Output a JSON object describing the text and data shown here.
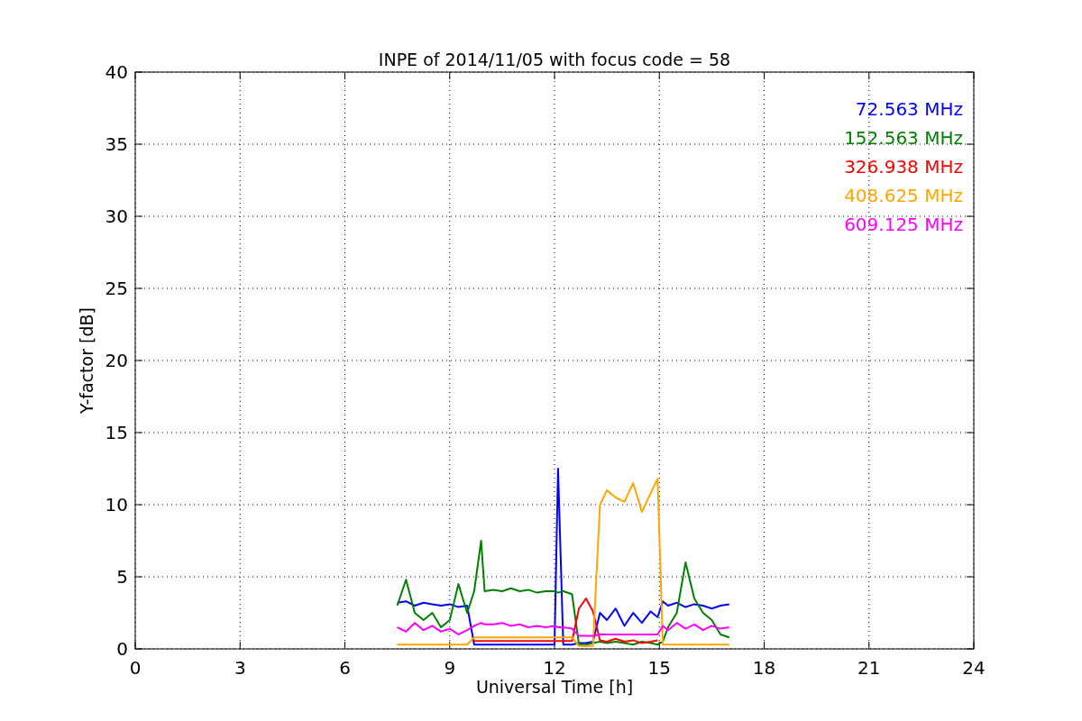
{
  "chart_data": {
    "type": "line",
    "title": "INPE of 2014/11/05 with focus code = 58",
    "xlabel": "Universal Time [h]",
    "ylabel": "Y-factor [dB]",
    "x": [
      7.5,
      7.75,
      8.0,
      8.25,
      8.5,
      8.75,
      9.0,
      9.25,
      9.5,
      9.7,
      9.9,
      10.0,
      10.25,
      10.5,
      10.75,
      11.0,
      11.25,
      11.5,
      11.75,
      12.0,
      12.1,
      12.25,
      12.5,
      12.7,
      12.9,
      13.1,
      13.3,
      13.5,
      13.75,
      14.0,
      14.25,
      14.5,
      14.75,
      14.95,
      15.1,
      15.25,
      15.5,
      15.75,
      16.0,
      16.25,
      16.5,
      16.75,
      17.0
    ],
    "series": [
      {
        "name": "72.563 MHz",
        "color": "#0000ff",
        "values": [
          3.2,
          3.3,
          3.0,
          3.2,
          3.1,
          3.0,
          3.1,
          2.9,
          3.0,
          0.3,
          0.3,
          0.3,
          0.3,
          0.3,
          0.3,
          0.3,
          0.3,
          0.3,
          0.3,
          0.3,
          12.5,
          0.3,
          0.3,
          0.4,
          0.4,
          0.5,
          2.5,
          2.0,
          2.8,
          1.6,
          2.5,
          1.8,
          2.6,
          2.2,
          3.3,
          3.0,
          3.2,
          2.9,
          3.1,
          3.0,
          2.8,
          3.0,
          3.1
        ]
      },
      {
        "name": "152.563 MHz",
        "color": "#008000",
        "values": [
          3.0,
          4.8,
          2.5,
          2.0,
          2.5,
          1.5,
          2.0,
          4.5,
          2.5,
          4.0,
          7.5,
          4.0,
          4.1,
          4.0,
          4.2,
          4.0,
          4.1,
          3.9,
          4.0,
          4.0,
          3.9,
          4.0,
          3.8,
          0.3,
          0.3,
          0.4,
          0.5,
          0.4,
          0.5,
          0.4,
          0.3,
          0.5,
          0.4,
          0.3,
          0.5,
          1.5,
          2.5,
          6.0,
          3.5,
          2.5,
          2.0,
          1.0,
          0.8
        ]
      },
      {
        "name": "326.938 MHz",
        "color": "#ff0000",
        "values": [
          null,
          null,
          null,
          null,
          null,
          null,
          null,
          null,
          null,
          0.55,
          0.55,
          0.55,
          0.55,
          0.55,
          0.55,
          0.55,
          0.55,
          0.55,
          0.55,
          0.55,
          0.55,
          0.55,
          0.55,
          2.8,
          3.5,
          2.6,
          0.6,
          0.5,
          0.7,
          0.5,
          0.6,
          0.4,
          0.5,
          0.6,
          null,
          null,
          null,
          null,
          null,
          null,
          null,
          null,
          null
        ]
      },
      {
        "name": "408.625 MHz",
        "color": "#ffa500",
        "values": [
          0.3,
          0.3,
          0.3,
          0.3,
          0.3,
          0.3,
          0.3,
          0.3,
          0.3,
          0.8,
          0.8,
          0.8,
          0.8,
          0.8,
          0.8,
          0.8,
          0.8,
          0.8,
          0.8,
          0.8,
          0.8,
          0.8,
          0.8,
          0.2,
          0.2,
          0.2,
          10.0,
          11.0,
          10.5,
          10.2,
          11.5,
          9.5,
          10.8,
          11.8,
          0.3,
          0.3,
          0.3,
          0.3,
          0.3,
          0.3,
          0.3,
          0.3,
          0.3
        ]
      },
      {
        "name": "609.125 MHz",
        "color": "#ff00ff",
        "values": [
          1.5,
          1.2,
          1.8,
          1.3,
          1.6,
          1.2,
          1.4,
          1.0,
          1.3,
          1.6,
          1.8,
          1.7,
          1.7,
          1.8,
          1.6,
          1.7,
          1.5,
          1.6,
          1.5,
          1.6,
          1.5,
          1.5,
          1.4,
          0.9,
          0.9,
          0.9,
          1.0,
          1.0,
          1.0,
          1.0,
          1.0,
          1.0,
          1.0,
          1.0,
          1.6,
          1.3,
          1.8,
          1.4,
          1.7,
          1.3,
          1.6,
          1.4,
          1.5
        ]
      }
    ],
    "grid": true,
    "xlim": [
      0,
      24
    ],
    "ylim": [
      0,
      40
    ],
    "xticks": [
      0,
      3,
      6,
      9,
      12,
      15,
      18,
      21,
      24
    ],
    "yticks": [
      0,
      5,
      10,
      15,
      20,
      25,
      30,
      35,
      40
    ]
  }
}
